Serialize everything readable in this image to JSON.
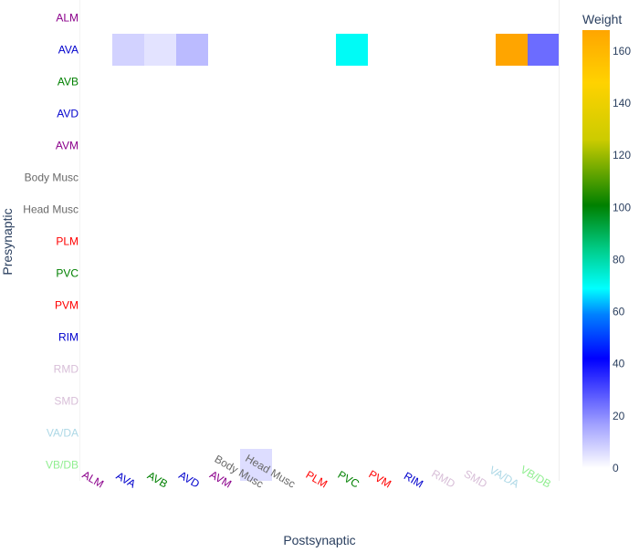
{
  "chart_data": {
    "type": "heatmap",
    "xlabel": "Postsynaptic",
    "ylabel": "Presynaptic",
    "colorbar_title": "Weight",
    "rows": [
      "ALM",
      "AVA",
      "AVB",
      "AVD",
      "AVM",
      "Body Musc",
      "Head Musc",
      "PLM",
      "PVC",
      "PVM",
      "RIM",
      "RMD",
      "SMD",
      "VA/DA",
      "VB/DB"
    ],
    "columns": [
      "ALM",
      "AVA",
      "AVB",
      "AVD",
      "AVM",
      "Body Musc",
      "Head Musc",
      "PLM",
      "PVC",
      "PVM",
      "RIM",
      "RMD",
      "SMD",
      "VA/DA",
      "VB/DB"
    ],
    "label_colors": {
      "ALM": "#8b008b",
      "AVA": "#0000cd",
      "AVB": "#008000",
      "AVD": "#0000cd",
      "AVM": "#8b008b",
      "Body Musc": "#696969",
      "Head Musc": "#696969",
      "PLM": "#ff0000",
      "PVC": "#008000",
      "PVM": "#ff0000",
      "RIM": "#0000cd",
      "RMD": "#d8bfd8",
      "SMD": "#d8bfd8",
      "VA/DA": "#add8e6",
      "VB/DB": "#90ee90"
    },
    "values": [
      [
        0,
        0,
        0,
        0,
        0,
        0,
        0,
        0,
        0,
        0,
        0,
        0,
        0,
        0,
        0
      ],
      [
        0,
        8,
        5,
        12,
        0,
        0,
        0,
        0,
        70,
        0,
        0,
        0,
        0,
        168,
        25
      ],
      [
        0,
        0,
        0,
        0,
        0,
        0,
        0,
        0,
        0,
        0,
        0,
        0,
        0,
        0,
        0
      ],
      [
        0,
        0,
        0,
        0,
        0,
        0,
        0,
        0,
        0,
        0,
        0,
        0,
        0,
        0,
        0
      ],
      [
        0,
        0,
        0,
        0,
        0,
        0,
        0,
        0,
        0,
        0,
        0,
        0,
        0,
        0,
        0
      ],
      [
        0,
        0,
        0,
        0,
        0,
        0,
        0,
        0,
        0,
        0,
        0,
        0,
        0,
        0,
        0
      ],
      [
        0,
        0,
        0,
        0,
        0,
        0,
        0,
        0,
        0,
        0,
        0,
        0,
        0,
        0,
        0
      ],
      [
        0,
        0,
        0,
        0,
        0,
        0,
        0,
        0,
        0,
        0,
        0,
        0,
        0,
        0,
        0
      ],
      [
        0,
        0,
        0,
        0,
        0,
        0,
        0,
        0,
        0,
        0,
        0,
        0,
        0,
        0,
        0
      ],
      [
        0,
        0,
        0,
        0,
        0,
        0,
        0,
        0,
        0,
        0,
        0,
        0,
        0,
        0,
        0
      ],
      [
        0,
        0,
        0,
        0,
        0,
        0,
        0,
        0,
        0,
        0,
        0,
        0,
        0,
        0,
        0
      ],
      [
        0,
        0,
        0,
        0,
        0,
        0,
        0,
        0,
        0,
        0,
        0,
        0,
        0,
        0,
        0
      ],
      [
        0,
        0,
        0,
        0,
        0,
        0,
        0,
        0,
        0,
        0,
        0,
        0,
        0,
        0,
        0
      ],
      [
        0,
        0,
        0,
        0,
        0,
        0,
        0,
        0,
        0,
        0,
        0,
        0,
        0,
        0,
        0
      ],
      [
        0,
        0,
        0,
        0,
        0,
        6,
        0,
        0,
        0,
        0,
        0,
        0,
        0,
        0,
        0
      ]
    ],
    "zrange": [
      0,
      168
    ],
    "colorscale": [
      [
        0.0,
        "#ffffff"
      ],
      [
        0.1,
        "#a0a0ff"
      ],
      [
        0.25,
        "#0000ff"
      ],
      [
        0.35,
        "#0080ff"
      ],
      [
        0.41,
        "#00ffff"
      ],
      [
        0.5,
        "#00cc88"
      ],
      [
        0.6,
        "#008000"
      ],
      [
        0.75,
        "#cccc00"
      ],
      [
        0.88,
        "#ffd200"
      ],
      [
        1.0,
        "#ffa500"
      ]
    ],
    "colorbar_ticks": [
      0,
      20,
      40,
      60,
      80,
      100,
      120,
      140,
      160
    ]
  }
}
